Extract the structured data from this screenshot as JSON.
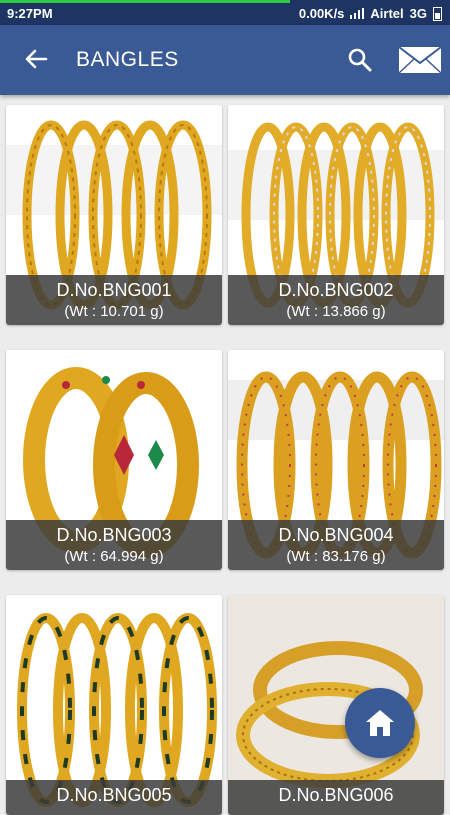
{
  "status_bar": {
    "time": "9:27PM",
    "speed": "0.00K/s",
    "carrier": "Airtel",
    "network": "3G"
  },
  "app_bar": {
    "title": "BANGLES",
    "back_icon": "arrow-left-icon",
    "search_icon": "search-icon",
    "mail_icon": "envelope-icon"
  },
  "products": [
    {
      "code": "D.No.BNG001",
      "weight": "(Wt : 10.701 g)"
    },
    {
      "code": "D.No.BNG002",
      "weight": "(Wt : 13.866 g)"
    },
    {
      "code": "D.No.BNG003",
      "weight": "(Wt : 64.994 g)"
    },
    {
      "code": "D.No.BNG004",
      "weight": "(Wt : 83.176 g)"
    },
    {
      "code": "D.No.BNG005",
      "weight": ""
    },
    {
      "code": "D.No.BNG006",
      "weight": ""
    }
  ],
  "fab": {
    "icon": "home-icon"
  },
  "colors": {
    "status_bar": "#1e3462",
    "app_bar": "#3a5a96",
    "caption_bg": "#3c3c3c",
    "gold": "#e0a820"
  }
}
